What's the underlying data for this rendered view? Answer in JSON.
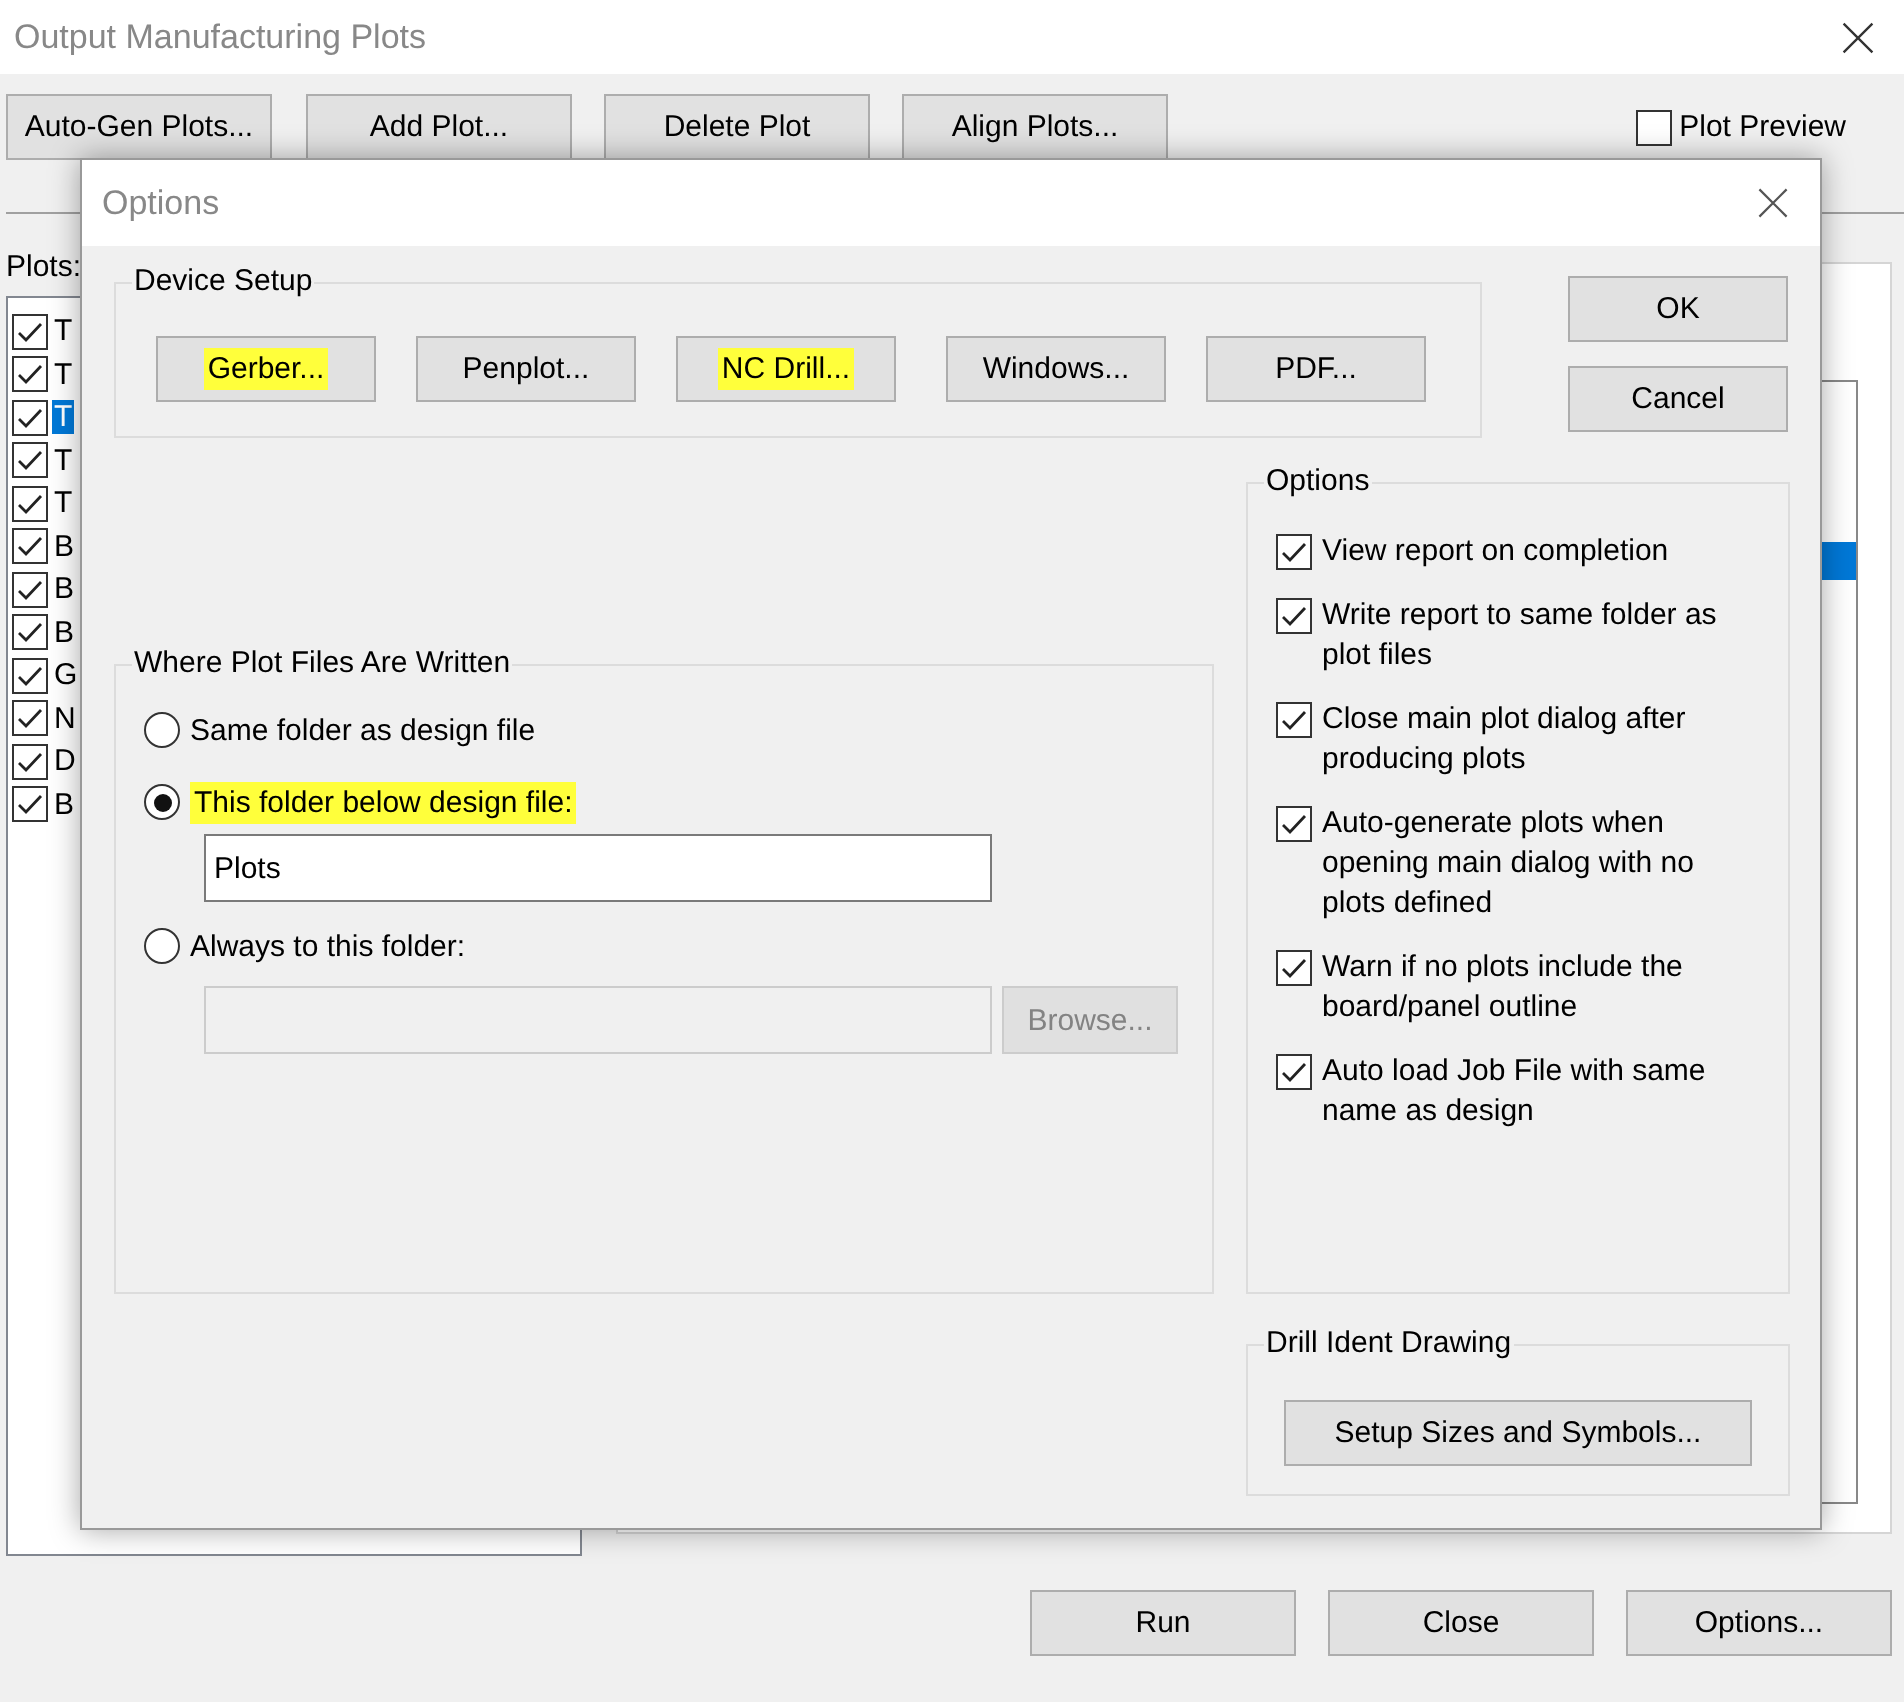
{
  "window": {
    "title": "Output Manufacturing Plots"
  },
  "toolbar": {
    "buttons": [
      "Auto-Gen Plots...",
      "Add Plot...",
      "Delete Plot",
      "Align Plots..."
    ],
    "plot_preview": {
      "label": "Plot Preview",
      "checked": false
    }
  },
  "plots": {
    "label": "Plots:",
    "items": [
      {
        "label": "T",
        "checked": true,
        "selected": false
      },
      {
        "label": "T",
        "checked": true,
        "selected": false
      },
      {
        "label": "T",
        "checked": true,
        "selected": true
      },
      {
        "label": "T",
        "checked": true,
        "selected": false
      },
      {
        "label": "T",
        "checked": true,
        "selected": false
      },
      {
        "label": "B",
        "checked": true,
        "selected": false
      },
      {
        "label": "B",
        "checked": true,
        "selected": false
      },
      {
        "label": "B",
        "checked": true,
        "selected": false
      },
      {
        "label": "G",
        "checked": true,
        "selected": false
      },
      {
        "label": "N",
        "checked": true,
        "selected": false
      },
      {
        "label": "D",
        "checked": true,
        "selected": false
      },
      {
        "label": "B",
        "checked": true,
        "selected": false
      }
    ]
  },
  "footer_buttons": [
    "Run",
    "Close",
    "Options..."
  ],
  "dialog": {
    "title": "Options",
    "device_setup": {
      "label": "Device Setup",
      "buttons": [
        {
          "label": "Gerber...",
          "highlighted": true
        },
        {
          "label": "Penplot...",
          "highlighted": false
        },
        {
          "label": "NC Drill...",
          "highlighted": true
        },
        {
          "label": "Windows...",
          "highlighted": false
        },
        {
          "label": "PDF...",
          "highlighted": false
        }
      ]
    },
    "buttons": [
      "OK",
      "Cancel"
    ],
    "where_written": {
      "label": "Where Plot Files Are Written",
      "options": [
        {
          "label": "Same folder as design file",
          "selected": false,
          "highlighted": false
        },
        {
          "label": "This folder below design file:",
          "selected": true,
          "highlighted": true,
          "value": "Plots"
        },
        {
          "label": "Always to this folder:",
          "selected": false,
          "highlighted": false,
          "value_disabled": true,
          "browse": "Browse..."
        }
      ]
    },
    "options": {
      "label": "Options",
      "items": [
        {
          "label": "View report on completion",
          "checked": true
        },
        {
          "label": "Write report to same folder as plot files",
          "checked": true
        },
        {
          "label": "Close main plot dialog after producing plots",
          "checked": true
        },
        {
          "label": "Auto-generate plots when opening main dialog with no plots defined",
          "checked": true
        },
        {
          "label": "Warn if no plots include the board/panel outline",
          "checked": true
        },
        {
          "label": "Auto load Job File with same name as design",
          "checked": true
        }
      ]
    },
    "drill_ident": {
      "label": "Drill Ident Drawing",
      "button": "Setup Sizes and Symbols..."
    }
  }
}
